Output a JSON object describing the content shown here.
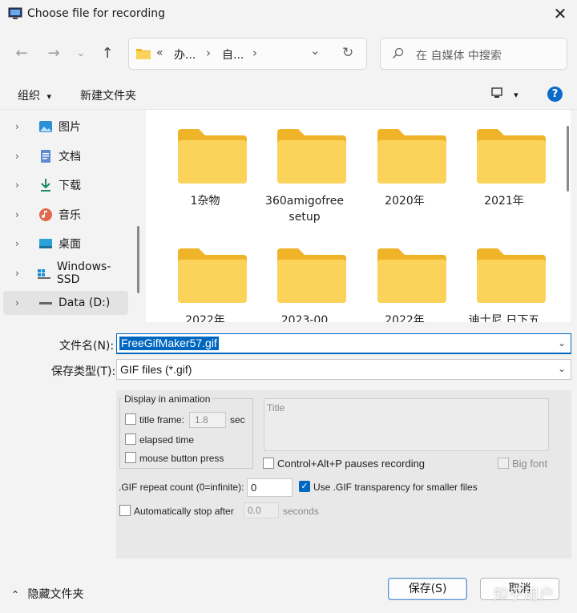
{
  "window": {
    "title": "Choose file for recording",
    "close_glyph": "✕"
  },
  "nav": {
    "back": "←",
    "forward": "→",
    "dropdown": "⌄",
    "up": "↑"
  },
  "address": {
    "crumb_overflow": "«",
    "crumbs": [
      "办...",
      "自..."
    ],
    "sep": "›",
    "dropdown": "⌄",
    "refresh": "↻"
  },
  "search": {
    "placeholder": "在 自媒体 中搜索"
  },
  "toolbar": {
    "organize": "组织",
    "organize_arrow": "▾",
    "new_folder": "新建文件夹",
    "view_arrow": "▾",
    "help": "?"
  },
  "sidebar": {
    "items": [
      {
        "label": "图片",
        "icon": "pictures-icon"
      },
      {
        "label": "文档",
        "icon": "documents-icon"
      },
      {
        "label": "下载",
        "icon": "downloads-icon"
      },
      {
        "label": "音乐",
        "icon": "music-icon"
      },
      {
        "label": "桌面",
        "icon": "desktop-icon"
      },
      {
        "label": "Windows-SSD",
        "icon": "drive-icon"
      },
      {
        "label": "Data (D:)",
        "icon": "drive-icon"
      }
    ],
    "chevron": "›"
  },
  "files": {
    "row1": [
      "1杂物",
      "360amigofree setup",
      "2020年",
      "2021年"
    ],
    "row2": [
      "2022年",
      "2023-00",
      "2022年",
      "迪士尼 日下五"
    ]
  },
  "form": {
    "filename_label": "文件名(N):",
    "filename_value": "FreeGifMaker57.gif",
    "filetype_label": "保存类型(T):",
    "filetype_value": "GIF files (*.gif)"
  },
  "options": {
    "group_title": "Display in animation",
    "title_frame_label": "title frame:",
    "title_frame_value": "1.8",
    "title_frame_unit": "sec",
    "elapsed_time_label": "elapsed time",
    "mouse_button_label": "mouse button press",
    "title_label": "Title",
    "control_label": "Control+Alt+P pauses recording",
    "big_font_label": "Big font",
    "repeat_label": ".GIF repeat count (0=infinite):",
    "repeat_value": "0",
    "transparency_label": "Use .GIF transparency for smaller files",
    "transparency_check": "✓",
    "auto_stop_label": "Automatically stop after",
    "auto_stop_value": "0.0",
    "auto_stop_unit": "seconds"
  },
  "footer": {
    "hide_folders": "隐藏文件夹",
    "hide_arrow": "⌃",
    "save": "保存(S)",
    "cancel": "取消",
    "watermark": "知乎用户"
  },
  "colors": {
    "accent": "#0067c0",
    "folder_back": "#f0b429",
    "folder_front": "#fcd35a"
  }
}
